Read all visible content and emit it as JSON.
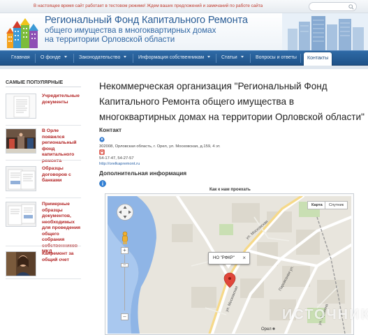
{
  "topbar": {
    "notice": "В настоящее время сайт работает в тестовом режиме! Ждем ваших предложений и замечаний по работе сайта",
    "search_placeholder": ""
  },
  "header": {
    "title_line1": "Региональный Фонд Капитального Ремонта",
    "title_line2": "общего имущества в многоквартирных домах",
    "title_line3": "на территории Орловской области"
  },
  "nav": {
    "items": [
      {
        "label": "Главная",
        "dropdown": false
      },
      {
        "label": "О фонде",
        "dropdown": true
      },
      {
        "label": "Законодательство",
        "dropdown": true
      },
      {
        "label": "Информация собственникам",
        "dropdown": true
      },
      {
        "label": "Статьи",
        "dropdown": true
      },
      {
        "label": "Вопросы и ответы",
        "dropdown": false
      },
      {
        "label": "Контакты",
        "dropdown": false,
        "active": true
      }
    ]
  },
  "sidebar": {
    "title": "САМЫЕ ПОПУЛЯРНЫЕ",
    "items": [
      {
        "caption": "Учредительные документы",
        "thumb": "document-thumb"
      },
      {
        "caption": "В Орле появился региональный фонд капитального ремонта",
        "thumb": "photo-thumb"
      },
      {
        "caption": "Образцы договоров с банками",
        "thumb": "document-thumb"
      },
      {
        "caption": "Примерные образцы документов, необходимых для проведения общего собрания собственников МКД",
        "thumb": "document-thumb"
      },
      {
        "caption": "Капремонт за общий счет",
        "thumb": "person-thumb"
      }
    ]
  },
  "main": {
    "title": "Некоммерческая организация \"Региональный Фонд Капитального Ремонта общего имущества в многоквартирных домах на территории Орловской области\"",
    "contact_heading": "Контакт",
    "address": "302008, Орловская область, г. Орел, ул. Московская, д.159, 4 эт.",
    "phone": "54-17-47, 54-27-57",
    "website": "http://orelkapremont.ru",
    "extra_heading": "Дополнительная информация",
    "map_heading": "Как к нам проехать"
  },
  "map": {
    "type_map": "Карта",
    "type_satellite": "Спутник",
    "popup_label": "НО \"РФКР\"",
    "streets": [
      "ул. Московская",
      "ул. Московская",
      "Паровозная ул.",
      "ул. Пушкина"
    ],
    "city_label": "Орел",
    "watermark": "ИСТОЧНИК"
  },
  "colors": {
    "brand_blue": "#2a5d96",
    "nav_blue": "#1f5288",
    "link_red": "#b22222",
    "notice_red": "#c0392b"
  }
}
